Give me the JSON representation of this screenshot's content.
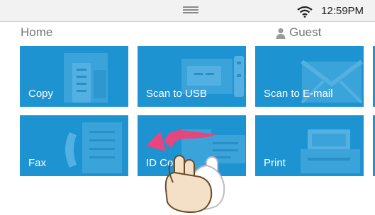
{
  "status_bar": {
    "time": "12:59PM",
    "wifi_icon": "wifi-icon",
    "handle_icon": "drag-handle-icon"
  },
  "header": {
    "title": "Home",
    "user": "Guest",
    "user_icon": "person-icon"
  },
  "tiles": [
    {
      "label": "Copy",
      "icon": "copy-icon"
    },
    {
      "label": "Scan to USB",
      "icon": "usb-scan-icon"
    },
    {
      "label": "Scan to E-mail",
      "icon": "envelope-icon"
    },
    {
      "label": "Fax",
      "icon": "fax-phone-icon"
    },
    {
      "label": "ID Copy",
      "icon": "id-card-icon"
    },
    {
      "label": "Print",
      "icon": "printer-icon"
    }
  ],
  "overlay": {
    "icon": "swipe-left-gesture-icon"
  },
  "colors": {
    "tile": "#1e93d1",
    "arrow": "#e8457c",
    "status_bar": "#f2f2f2"
  }
}
